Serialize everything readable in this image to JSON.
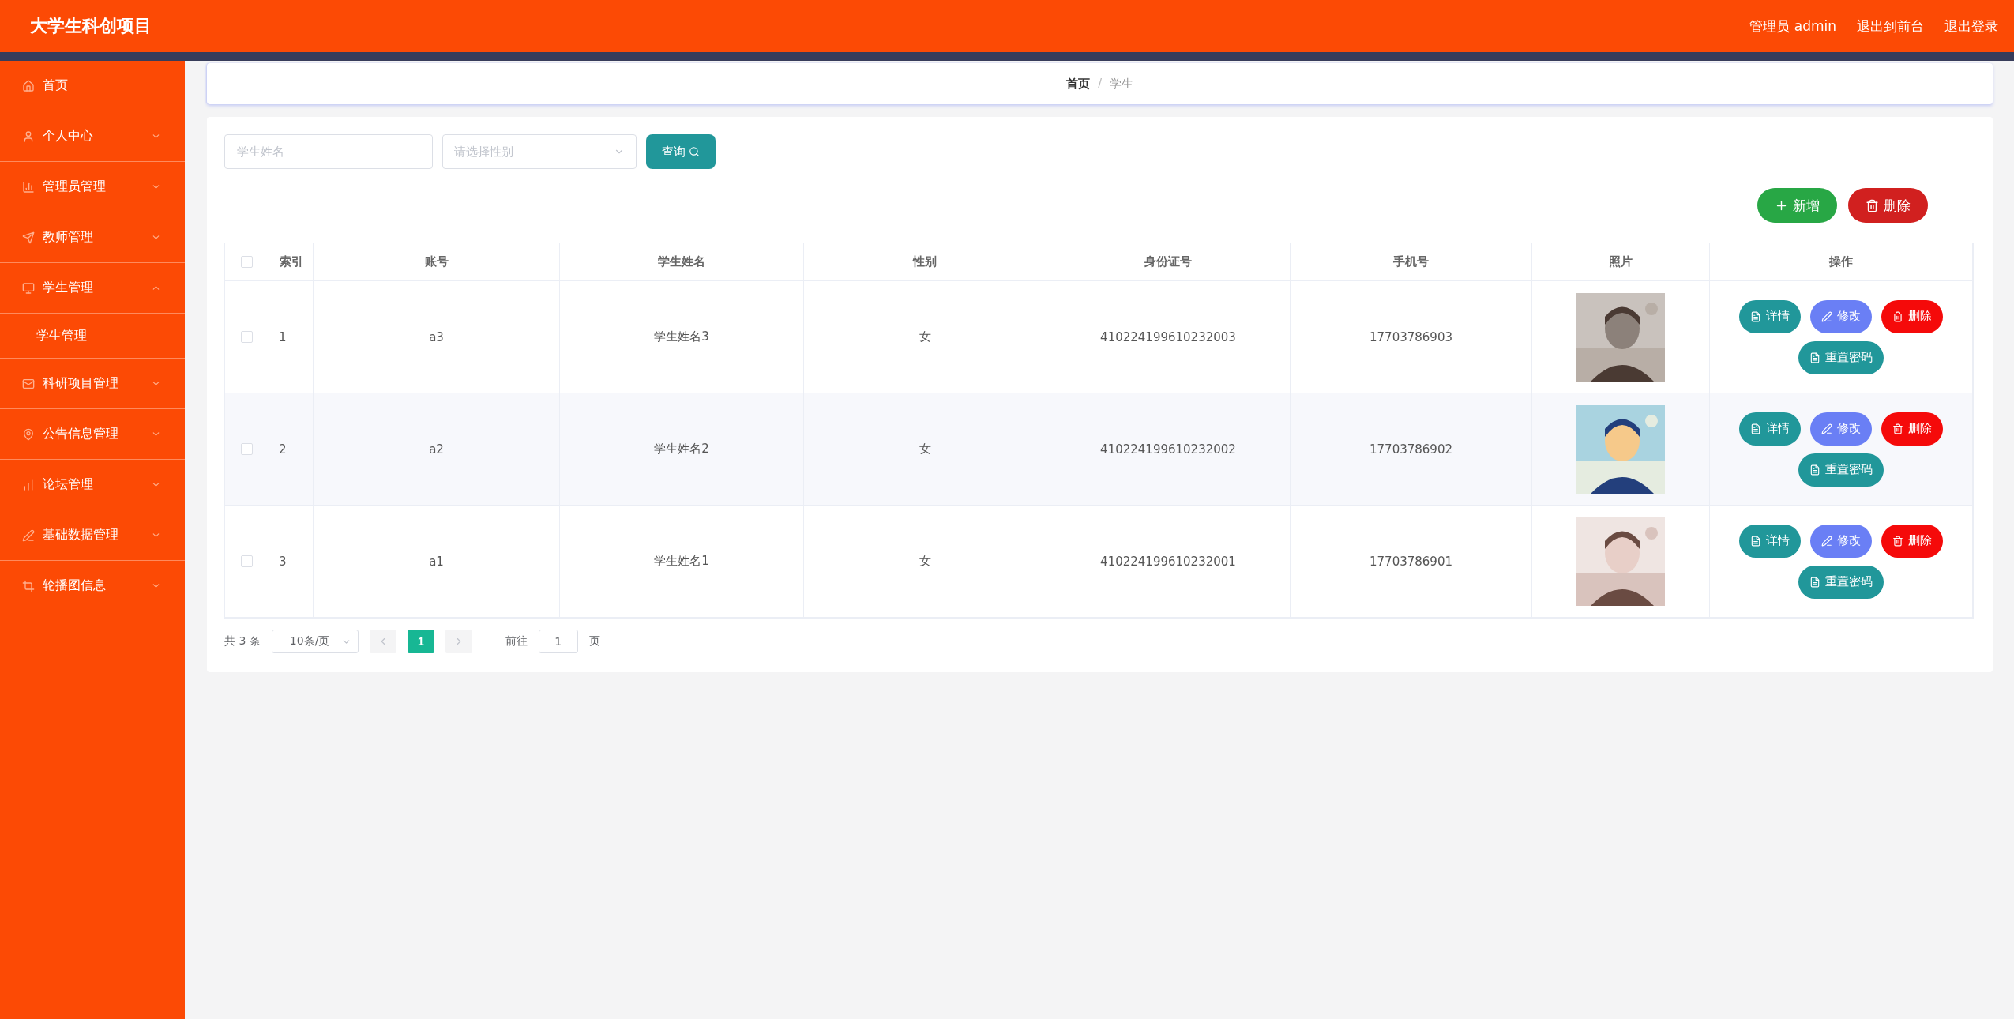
{
  "header": {
    "title": "大学生科创项目",
    "links": [
      "管理员 admin",
      "退出到前台",
      "退出登录"
    ]
  },
  "sidebar": {
    "items": [
      {
        "label": "首页",
        "kind": "link"
      },
      {
        "label": "个人中心",
        "kind": "menu",
        "expanded": false
      },
      {
        "label": "管理员管理",
        "kind": "menu",
        "expanded": false
      },
      {
        "label": "教师管理",
        "kind": "menu",
        "expanded": false
      },
      {
        "label": "学生管理",
        "kind": "menu",
        "expanded": true,
        "children": [
          {
            "label": "学生管理"
          }
        ]
      },
      {
        "label": "科研项目管理",
        "kind": "menu",
        "expanded": false
      },
      {
        "label": "公告信息管理",
        "kind": "menu",
        "expanded": false
      },
      {
        "label": "论坛管理",
        "kind": "menu",
        "expanded": false
      },
      {
        "label": "基础数据管理",
        "kind": "menu",
        "expanded": false
      },
      {
        "label": "轮播图信息",
        "kind": "menu",
        "expanded": false
      }
    ]
  },
  "breadcrumb": [
    "首页",
    "学生"
  ],
  "breadcrumb_separator": "/",
  "search": {
    "name_placeholder": "学生姓名",
    "gender_placeholder": "请选择性别",
    "button": "查询"
  },
  "toolbar": [
    {
      "label": "新增",
      "kind": "add"
    },
    {
      "label": "删除",
      "kind": "delete"
    }
  ],
  "table": {
    "select_all_checked": false,
    "columns": [
      "索引",
      "账号",
      "学生姓名",
      "性别",
      "身份证号",
      "手机号",
      "照片",
      "操作"
    ],
    "rows": [
      {
        "checked": false,
        "cells": [
          "1",
          "a3",
          "学生姓名3",
          "女",
          "410224199610232003",
          "17703786903"
        ],
        "actions": [
          {
            "label": "详情",
            "kind": "detail"
          },
          {
            "label": "修改",
            "kind": "edit"
          },
          {
            "label": "删除",
            "kind": "delete"
          },
          {
            "label": "重置密码",
            "kind": "reset"
          }
        ]
      },
      {
        "checked": false,
        "cells": [
          "2",
          "a2",
          "学生姓名2",
          "女",
          "410224199610232002",
          "17703786902"
        ],
        "actions": [
          {
            "label": "详情",
            "kind": "detail"
          },
          {
            "label": "修改",
            "kind": "edit"
          },
          {
            "label": "删除",
            "kind": "delete"
          },
          {
            "label": "重置密码",
            "kind": "reset"
          }
        ]
      },
      {
        "checked": false,
        "cells": [
          "3",
          "a1",
          "学生姓名1",
          "女",
          "410224199610232001",
          "17703786901"
        ],
        "actions": [
          {
            "label": "详情",
            "kind": "detail"
          },
          {
            "label": "修改",
            "kind": "edit"
          },
          {
            "label": "删除",
            "kind": "delete"
          },
          {
            "label": "重置密码",
            "kind": "reset"
          }
        ]
      }
    ]
  },
  "pagination": {
    "total": "共 3 条",
    "page_size": "10条/页",
    "pages": [
      {
        "label": "1",
        "selected": true
      }
    ],
    "goto_label": "前往",
    "goto_value": "1",
    "goto_suffix": "页"
  }
}
